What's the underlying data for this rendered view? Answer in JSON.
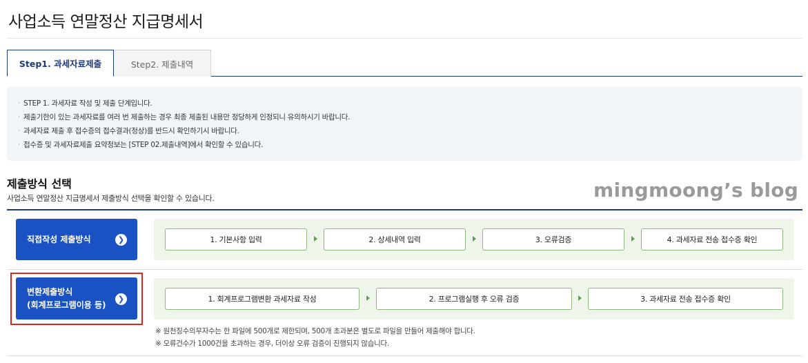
{
  "page": {
    "title": "사업소득 연말정산 지급명세서"
  },
  "tabs": [
    {
      "label": "Step1. 과세자료제출",
      "active": true
    },
    {
      "label": "Step2. 제출내역",
      "active": false
    }
  ],
  "notice": {
    "items": [
      "STEP 1. 과세자료 작성 및 제출 단계입니다.",
      "제출기한이 있는 과세자료를 여러 번 제출하는 경우 최종 제출된 내용만 정당하게 인정되니 유의하시기 바랍니다.",
      "과세자료 제출 후 접수증의 접수결과(정상)를 반드시 확인하기시 바랍니다.",
      "접수증 및 과세자료제출 요약정보는 [STEP 02.제출내역]에서 확인할 수 있습니다."
    ]
  },
  "section": {
    "title": "제출방식 선택",
    "description": "사업소득 연말정산 지급명세서 제출방식 선택을 확인할 수 있습니다."
  },
  "watermark": "mingmoong’s blog",
  "methods": {
    "direct": {
      "label": "직접작성 제출방식",
      "steps": [
        "1. 기본사항 입력",
        "2. 상세내역 입력",
        "3. 오류검증",
        "4. 과세자료 전송 접수증 확인"
      ]
    },
    "convert": {
      "label_line1": "변환제출방식",
      "label_line2": "(회계프로그램이용 등)",
      "steps": [
        "1. 회계프로그램변환 과세자료 작성",
        "2. 프로그램실행 후 오류 검증",
        "3. 과세자료 전송 접수증 확인"
      ],
      "notes": [
        "※ 원천징수의무자수는 한 파일에 500개로 제한되며, 500개 초과분은 별도로 파일을 만들어 제출해야 합니다.",
        "※ 오류건수가 1000건을 초과하는 경우, 더이상 오류 검증이 진행되지 않습니다."
      ]
    }
  },
  "colors": {
    "accent": "#1a52c4",
    "tab_border": "#1c3b7a",
    "highlight": "#d8281f",
    "step_bg": "#f0f5ec",
    "step_border": "#8fb881"
  }
}
